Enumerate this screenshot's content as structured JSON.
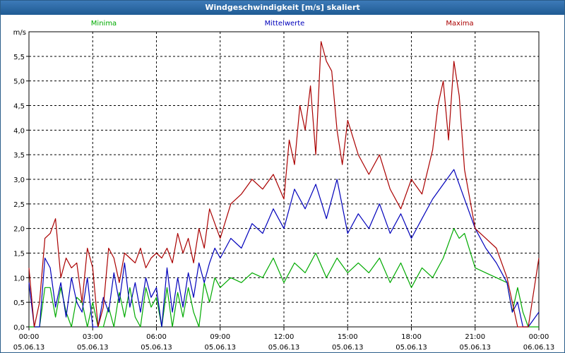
{
  "window": {
    "title": "Windgeschwindigkeit [m/s] skaliert"
  },
  "chart_data": {
    "type": "line",
    "title": "Windgeschwindigkeit [m/s] skaliert",
    "ylabel": "m/s",
    "ylim": [
      0,
      6.0
    ],
    "xlim": [
      0,
      24
    ],
    "grid": true,
    "y_ticks": [
      {
        "v": 0.0,
        "label": "0,0"
      },
      {
        "v": 0.5,
        "label": "0,5"
      },
      {
        "v": 1.0,
        "label": "1,0"
      },
      {
        "v": 1.5,
        "label": "1,5"
      },
      {
        "v": 2.0,
        "label": "2,0"
      },
      {
        "v": 2.5,
        "label": "2,5"
      },
      {
        "v": 3.0,
        "label": "3,0"
      },
      {
        "v": 3.5,
        "label": "3,5"
      },
      {
        "v": 4.0,
        "label": "4,0"
      },
      {
        "v": 4.5,
        "label": "4,5"
      },
      {
        "v": 5.0,
        "label": "5,0"
      },
      {
        "v": 5.5,
        "label": "5,5"
      }
    ],
    "x_ticks": [
      {
        "v": 0,
        "time": "00:00",
        "date": "05.06.13"
      },
      {
        "v": 3,
        "time": "03:00",
        "date": "05.06.13"
      },
      {
        "v": 6,
        "time": "06:00",
        "date": "05.06.13"
      },
      {
        "v": 9,
        "time": "09:00",
        "date": "05.06.13"
      },
      {
        "v": 12,
        "time": "12:00",
        "date": "05.06.13"
      },
      {
        "v": 15,
        "time": "15:00",
        "date": "05.06.13"
      },
      {
        "v": 18,
        "time": "18:00",
        "date": "05.06.13"
      },
      {
        "v": 21,
        "time": "21:00",
        "date": "05.06.13"
      },
      {
        "v": 24,
        "time": "00:00",
        "date": "06.06.13"
      }
    ],
    "series": [
      {
        "name": "Minima",
        "color": "#00aa00",
        "x": [
          0,
          0.5,
          0.75,
          1,
          1.25,
          1.5,
          1.75,
          2,
          2.25,
          2.5,
          2.75,
          3,
          3.25,
          3.5,
          3.75,
          4,
          4.25,
          4.5,
          4.75,
          5,
          5.25,
          5.5,
          5.75,
          6,
          6.25,
          6.5,
          6.75,
          7,
          7.25,
          7.5,
          7.75,
          8,
          8.25,
          8.5,
          8.75,
          9,
          9.5,
          10,
          10.5,
          11,
          11.5,
          12,
          12.5,
          13,
          13.5,
          14,
          14.5,
          15,
          15.5,
          16,
          16.5,
          17,
          17.5,
          18,
          18.5,
          19,
          19.5,
          20,
          20.25,
          20.5,
          21,
          21.5,
          22,
          22.5,
          22.75,
          23,
          23.25,
          23.5,
          24
        ],
        "y": [
          0,
          0,
          0.8,
          0.8,
          0.2,
          0.8,
          0.3,
          0,
          0.6,
          0.5,
          0,
          0.5,
          0,
          0,
          0.4,
          0,
          0.7,
          0.2,
          0.8,
          0.2,
          0,
          0.8,
          0.4,
          0.6,
          0,
          0.8,
          0,
          0.7,
          0.2,
          0.8,
          0.3,
          0,
          0.9,
          0.5,
          1.0,
          0.8,
          1.0,
          0.9,
          1.1,
          1.0,
          1.4,
          0.9,
          1.3,
          1.1,
          1.5,
          1.0,
          1.4,
          1.1,
          1.3,
          1.1,
          1.4,
          0.9,
          1.3,
          0.8,
          1.2,
          1.0,
          1.4,
          2.0,
          1.8,
          1.9,
          1.2,
          1.1,
          1.0,
          0.9,
          0.3,
          0.8,
          0.3,
          0,
          0
        ]
      },
      {
        "name": "Mittelwerte",
        "color": "#0000bb",
        "x": [
          0,
          0.25,
          0.5,
          0.75,
          1,
          1.25,
          1.5,
          1.75,
          2,
          2.25,
          2.5,
          2.75,
          3,
          3.25,
          3.5,
          3.75,
          4,
          4.25,
          4.5,
          4.75,
          5,
          5.25,
          5.5,
          5.75,
          6,
          6.25,
          6.5,
          6.75,
          7,
          7.25,
          7.5,
          7.75,
          8,
          8.25,
          8.5,
          8.75,
          9,
          9.5,
          10,
          10.5,
          11,
          11.5,
          12,
          12.5,
          13,
          13.5,
          14,
          14.5,
          15,
          15.5,
          16,
          16.5,
          17,
          17.5,
          18,
          18.5,
          19,
          19.5,
          20,
          20.5,
          21,
          21.5,
          22,
          22.5,
          22.75,
          23,
          23.25,
          23.5,
          24
        ],
        "y": [
          0.9,
          0,
          0,
          1.4,
          1.2,
          0.4,
          0.9,
          0.2,
          1.0,
          0.5,
          0.3,
          1.0,
          0,
          0,
          0.6,
          0.3,
          1.1,
          0.5,
          1.3,
          0.4,
          0.9,
          0.3,
          1.0,
          0.6,
          0.8,
          0,
          1.2,
          0.3,
          1.0,
          0.4,
          1.1,
          0.6,
          1.3,
          0.9,
          1.3,
          1.6,
          1.4,
          1.8,
          1.6,
          2.1,
          1.9,
          2.4,
          2.0,
          2.8,
          2.4,
          2.9,
          2.2,
          3.0,
          1.9,
          2.3,
          2.0,
          2.5,
          1.9,
          2.3,
          1.8,
          2.2,
          2.6,
          2.9,
          3.2,
          2.6,
          2.0,
          1.6,
          1.3,
          0.9,
          0.3,
          0.5,
          0,
          0,
          0.3
        ]
      },
      {
        "name": "Maxima",
        "color": "#aa0000",
        "x": [
          0,
          0.25,
          0.5,
          0.75,
          1,
          1.25,
          1.5,
          1.75,
          2,
          2.25,
          2.5,
          2.75,
          3,
          3.25,
          3.5,
          3.75,
          4,
          4.25,
          4.5,
          4.75,
          5,
          5.25,
          5.5,
          5.75,
          6,
          6.25,
          6.5,
          6.75,
          7,
          7.25,
          7.5,
          7.75,
          8,
          8.25,
          8.5,
          8.75,
          9,
          9.5,
          10,
          10.5,
          11,
          11.5,
          12,
          12.25,
          12.5,
          12.75,
          13,
          13.25,
          13.5,
          13.75,
          14,
          14.25,
          14.5,
          14.75,
          15,
          15.5,
          16,
          16.5,
          17,
          17.5,
          18,
          18.5,
          19,
          19.25,
          19.5,
          19.75,
          20,
          20.25,
          20.5,
          21,
          21.5,
          22,
          22.5,
          22.75,
          23,
          23.25,
          23.5,
          24
        ],
        "y": [
          1.2,
          0,
          0.5,
          1.8,
          1.9,
          2.2,
          1.0,
          1.4,
          1.2,
          1.3,
          0.5,
          1.6,
          1.2,
          0,
          0.4,
          1.6,
          1.4,
          0.9,
          1.5,
          1.4,
          1.3,
          1.6,
          1.2,
          1.4,
          1.5,
          1.4,
          1.6,
          1.3,
          1.9,
          1.5,
          1.8,
          1.3,
          2.0,
          1.6,
          2.4,
          2.1,
          1.8,
          2.5,
          2.7,
          3.0,
          2.8,
          3.1,
          2.6,
          3.8,
          3.3,
          4.5,
          4.0,
          4.9,
          3.5,
          5.8,
          5.4,
          5.2,
          4.0,
          3.3,
          4.2,
          3.5,
          3.1,
          3.5,
          2.8,
          2.4,
          3.0,
          2.7,
          3.6,
          4.5,
          5.0,
          3.8,
          5.4,
          4.7,
          3.2,
          2.0,
          1.8,
          1.6,
          1.0,
          0.5,
          0,
          0,
          0,
          1.4
        ]
      }
    ]
  }
}
